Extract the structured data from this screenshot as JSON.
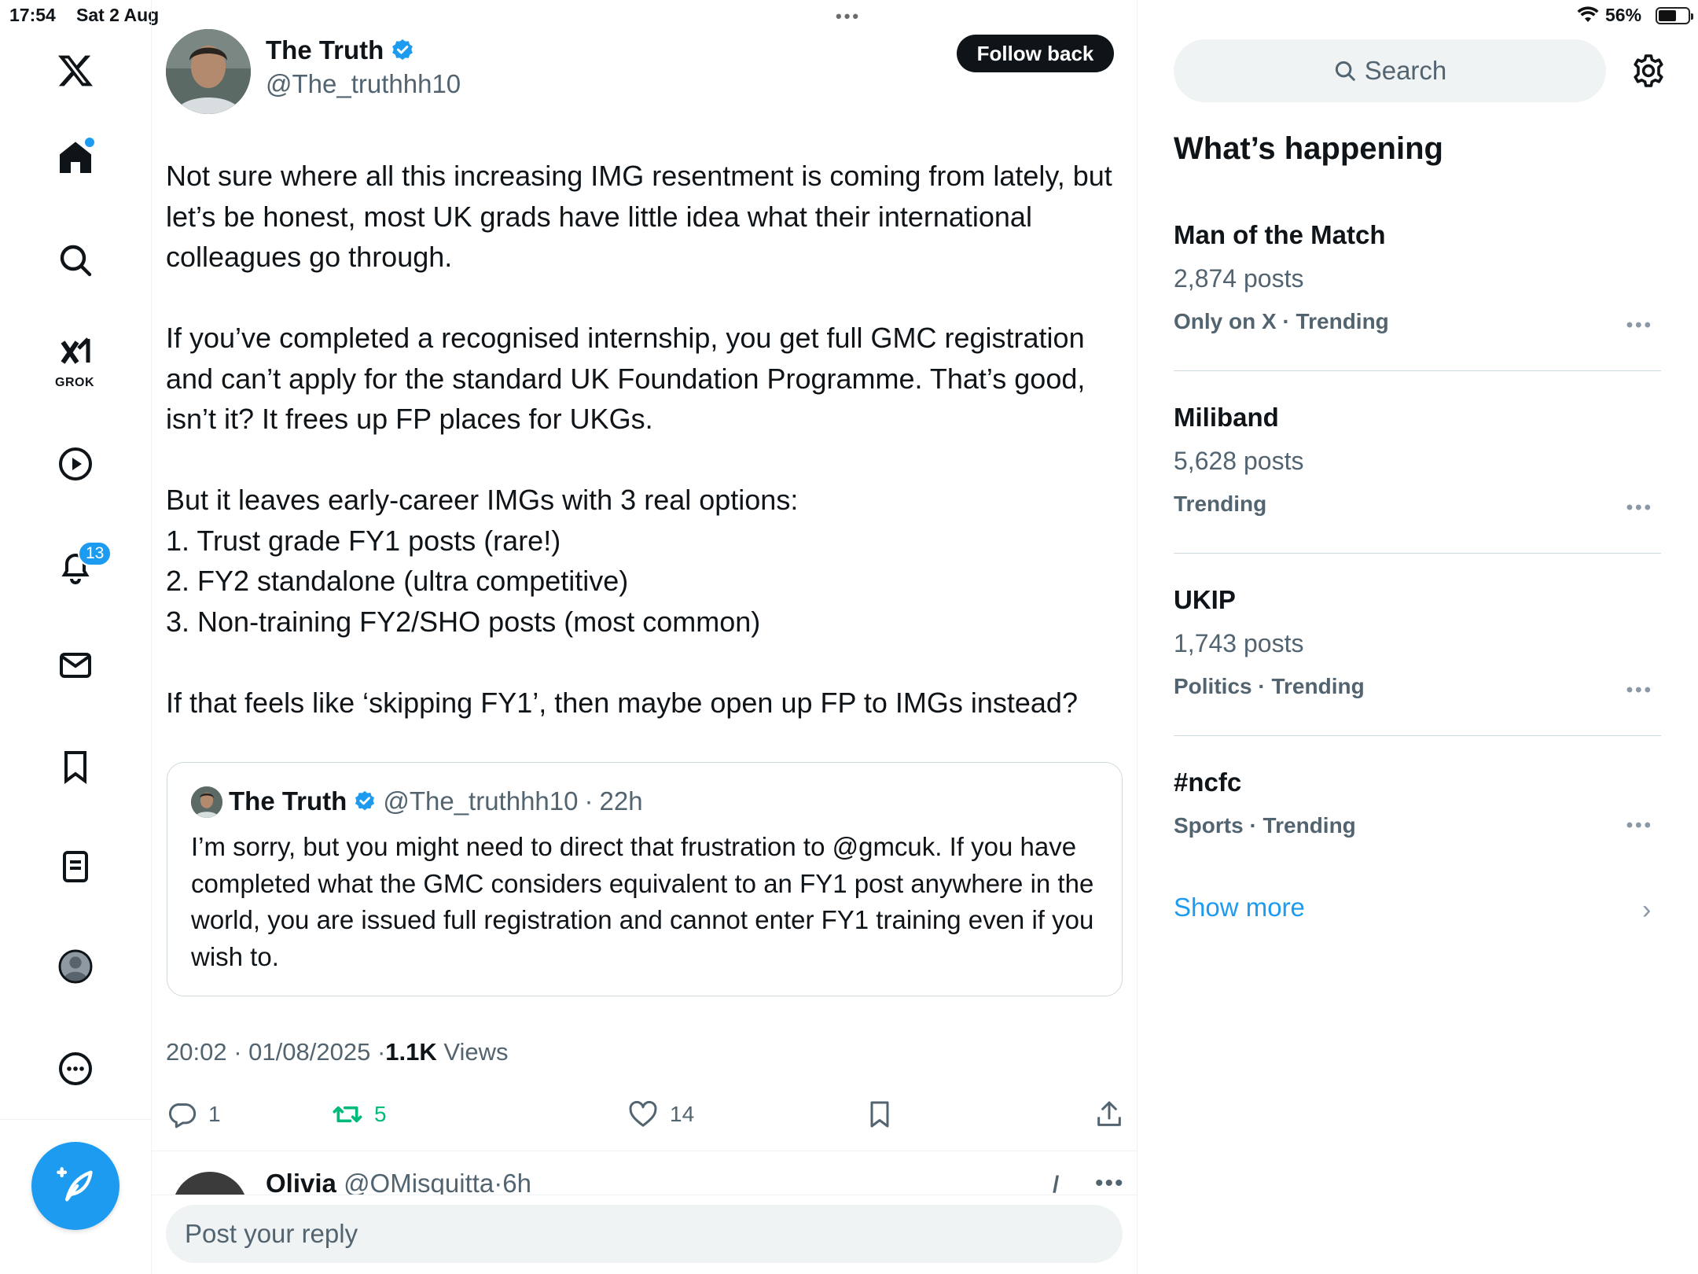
{
  "status_bar": {
    "time": "17:54",
    "date": "Sat 2 Aug",
    "battery": "56%",
    "battery_level": 0.56
  },
  "nav": {
    "notifications_badge": "13",
    "grok_label": "GROK"
  },
  "tweet": {
    "author_name": "The Truth",
    "author_handle": "@The_truthhh10",
    "follow_label": "Follow back",
    "text": "Not sure where all this increasing IMG resentment is coming from lately, but let’s be honest, most UK grads have little idea what their international colleagues go through.\n\nIf you’ve completed a recognised internship, you get full GMC registration and can’t apply for the standard UK Foundation Programme. That’s good, isn’t it? It frees up FP places for UKGs.\n\nBut it leaves early-career IMGs with 3 real options:\n1. Trust grade FY1 posts (rare!)\n2. FY2 standalone (ultra competitive)\n3. Non-training FY2/SHO posts (most common)\n\nIf that feels like ‘skipping FY1’, then maybe open up FP to IMGs instead?",
    "quote": {
      "name": "The Truth",
      "handle": "@The_truthhh10",
      "separator": "·",
      "age": "22h",
      "text": "I’m sorry, but you might need to direct that frustration to @gmcuk. If you have completed what the GMC considers equivalent to an FY1 post anywhere in the world, you are issued full registration and cannot enter FY1 training even if you wish to."
    },
    "time": "20:02",
    "date": "01/08/2025",
    "dot": "·",
    "views_count": "1.1K",
    "views_label": "Views",
    "replies": "1",
    "reposts": "5",
    "likes": "14"
  },
  "reply_preview": {
    "name": "Olivia",
    "handle": "@OMisquitta",
    "separator": "·",
    "age": "6h",
    "more": "•••"
  },
  "composer": {
    "placeholder": "Post your reply"
  },
  "sidebar": {
    "search_placeholder": "Search",
    "whats_happening": "What’s happening",
    "trends": [
      {
        "name": "Man of the Match",
        "posts": "2,874 posts",
        "meta": "Only on X · Trending",
        "more": "•••"
      },
      {
        "name": "Miliband",
        "posts": "5,628 posts",
        "meta": "Trending",
        "more": "•••"
      },
      {
        "name": "UKIP",
        "posts": "1,743 posts",
        "meta": "Politics · Trending",
        "more": "•••"
      },
      {
        "name": "#ncfc",
        "posts": "",
        "meta": "Sports · Trending",
        "more": "•••"
      }
    ],
    "show_more": "Show more"
  },
  "colors": {
    "accent": "#1d9bf0",
    "repost": "#00ba7c",
    "text": "#0f1419",
    "muted": "#536471"
  }
}
